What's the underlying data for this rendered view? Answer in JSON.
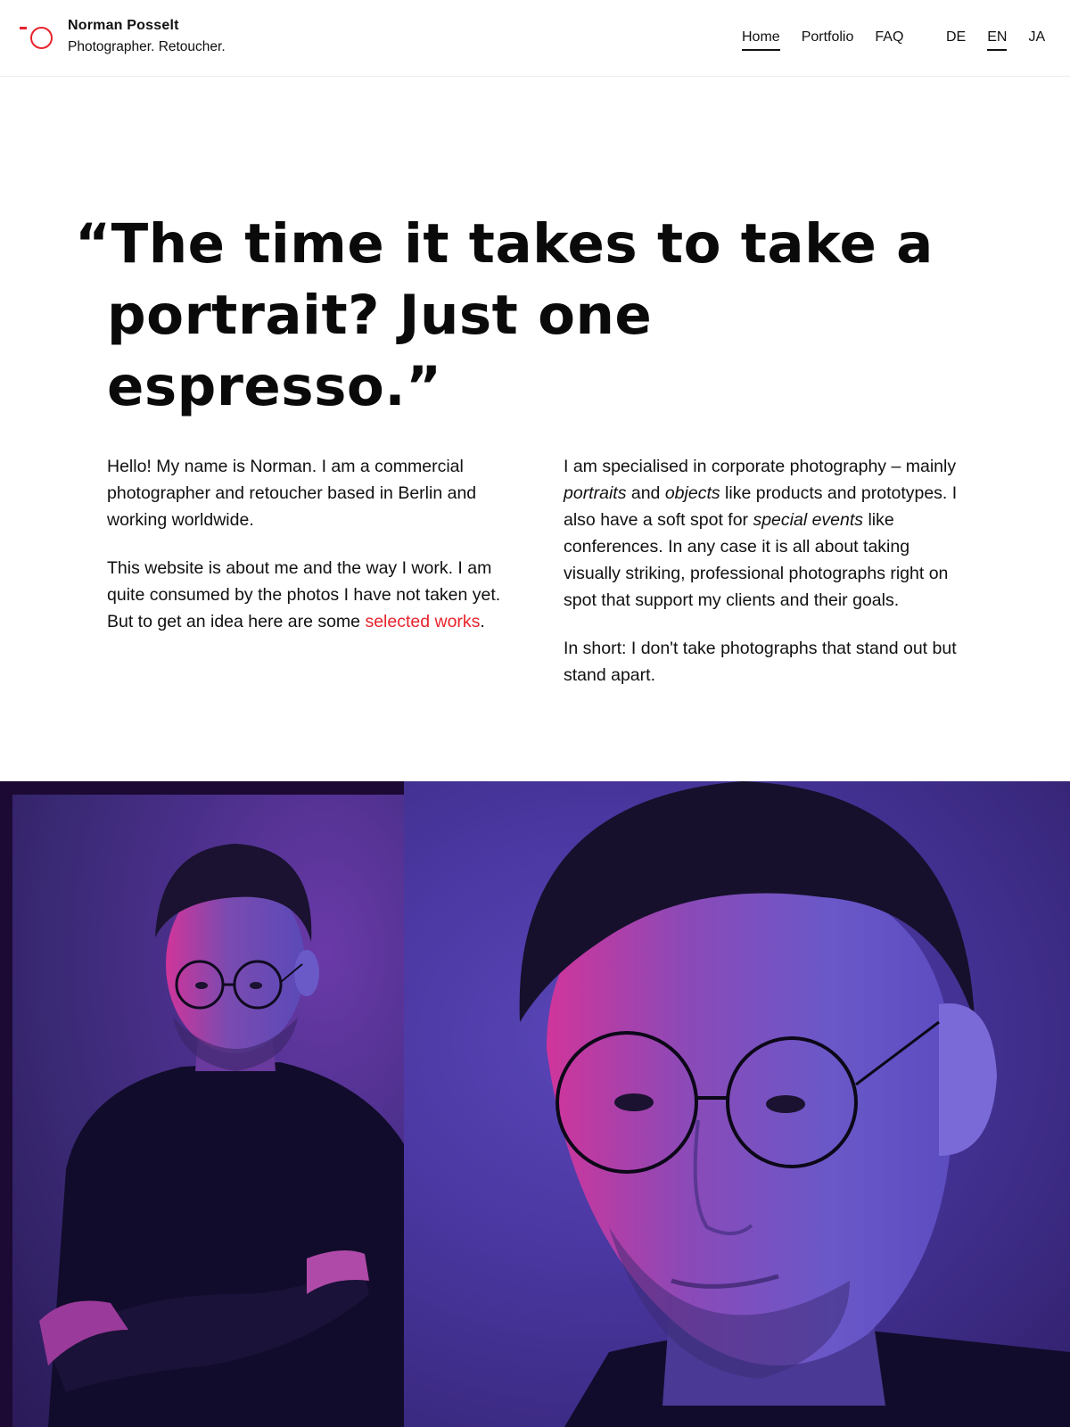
{
  "header": {
    "name": "Norman Posselt",
    "tagline": "Photographer. Retoucher."
  },
  "nav": {
    "items": [
      {
        "label": "Home",
        "active": true
      },
      {
        "label": "Portfolio",
        "active": false
      },
      {
        "label": "FAQ",
        "active": false
      }
    ],
    "languages": [
      {
        "label": "DE",
        "active": false
      },
      {
        "label": "EN",
        "active": true
      },
      {
        "label": "JA",
        "active": false
      }
    ]
  },
  "hero": {
    "quote_line1": "“The time it takes to take a",
    "quote_line2": "portrait? Just one espresso.”"
  },
  "intro": {
    "left": {
      "p1": "Hello! My name is Norman. I am a commercial photographer and retoucher based in Berlin and working worldwide.",
      "p2_text": "This website is about me and the way I work. I am quite consumed by the photos I have not taken yet. But to get an idea here are some ",
      "p2_link": "selected works",
      "p2_end": "."
    },
    "right": {
      "p1_a": "I am specialised in corporate photography – mainly ",
      "p1_em1": "portraits",
      "p1_b": " and ",
      "p1_em2": "objects",
      "p1_c": " like products and prototypes. I also have a soft spot for ",
      "p1_em3": "special events",
      "p1_d": " like conferences. In any case it is all about taking visually striking, professional photographs right on spot that support my clients and their goals.",
      "p2": "In short: I don't take photographs that stand out but stand apart."
    }
  },
  "colors": {
    "accent": "#e8232c",
    "photo_bg": "#1c0a35"
  },
  "icons": {
    "logo": "camera-logo-icon"
  }
}
